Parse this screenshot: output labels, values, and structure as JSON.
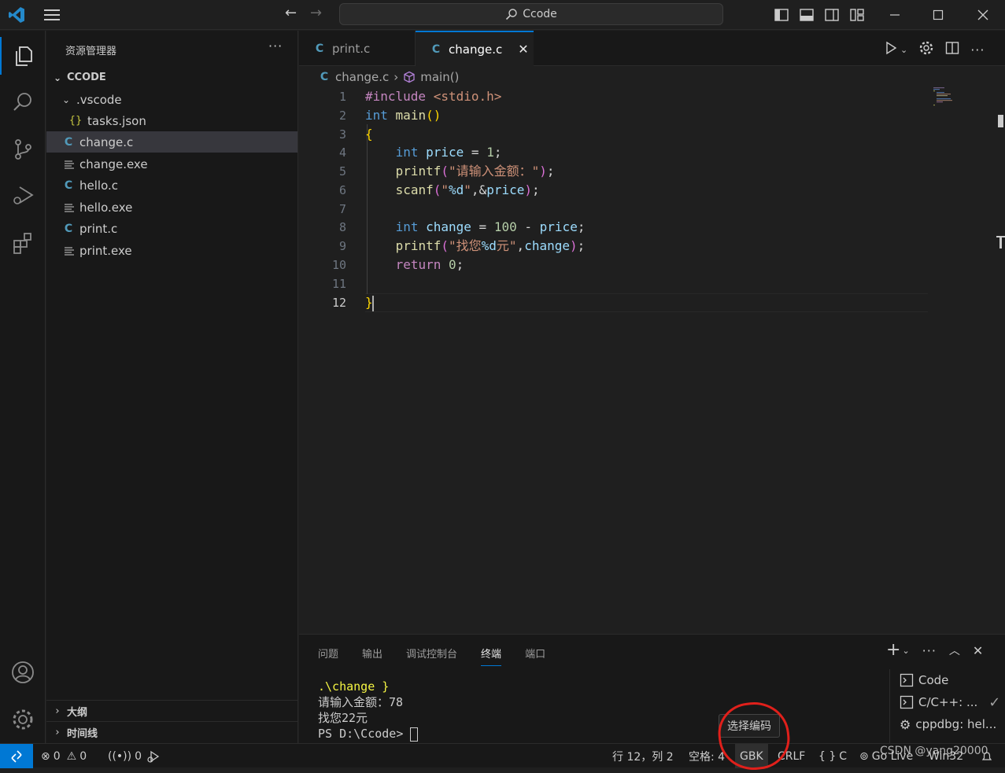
{
  "titlebar": {
    "search_text": "Ccode"
  },
  "sidebar": {
    "title": "资源管理器",
    "root": "CCODE",
    "items": [
      {
        "label": ".vscode",
        "type": "folder"
      },
      {
        "label": "tasks.json",
        "type": "json"
      },
      {
        "label": "change.c",
        "type": "c",
        "selected": true
      },
      {
        "label": "change.exe",
        "type": "exe"
      },
      {
        "label": "hello.c",
        "type": "c"
      },
      {
        "label": "hello.exe",
        "type": "exe"
      },
      {
        "label": "print.c",
        "type": "c"
      },
      {
        "label": "print.exe",
        "type": "exe"
      }
    ],
    "outline": "大纲",
    "timeline": "时间线"
  },
  "tabs": [
    {
      "label": "print.c",
      "active": false
    },
    {
      "label": "change.c",
      "active": true
    }
  ],
  "breadcrumb": {
    "file": "change.c",
    "symbol": "main()"
  },
  "editor": {
    "line_numbers": [
      "1",
      "2",
      "3",
      "4",
      "5",
      "6",
      "7",
      "8",
      "9",
      "10",
      "11",
      "12"
    ],
    "current_line": 12,
    "lines": [
      "#include <stdio.h>",
      "int main()",
      "{",
      "    int price = 1;",
      "    printf(\"请输入金额：\");",
      "    scanf(\"%d\",&price);",
      "",
      "    int change = 100 - price;",
      "    printf(\"找您%d元\",change);",
      "    return 0;",
      "",
      "}"
    ]
  },
  "panel": {
    "tabs": [
      "问题",
      "输出",
      "调试控制台",
      "终端",
      "端口"
    ],
    "active_tab": "终端",
    "terminal_lines": [
      ".\\change }",
      "请输入金额：78",
      "找您22元",
      "PS D:\\Ccode> "
    ],
    "terminals": [
      "Code",
      "C/C++: ...",
      "cppdbg: hel..."
    ]
  },
  "status": {
    "errors": "0",
    "warnings": "0",
    "ports": "0",
    "position": "行 12，列 2",
    "spaces": "空格: 4",
    "encoding": "GBK",
    "eol": "CRLF",
    "language": "C",
    "golive": "Go Live",
    "platform": "Win32"
  },
  "tooltip": {
    "text": "选择编码"
  },
  "watermark": "CSDN @yang20000",
  "colors": {
    "accent": "#0078d4",
    "bg": "#1f1f1f",
    "sidebar_bg": "#181818",
    "annotation": "#e0201b"
  }
}
